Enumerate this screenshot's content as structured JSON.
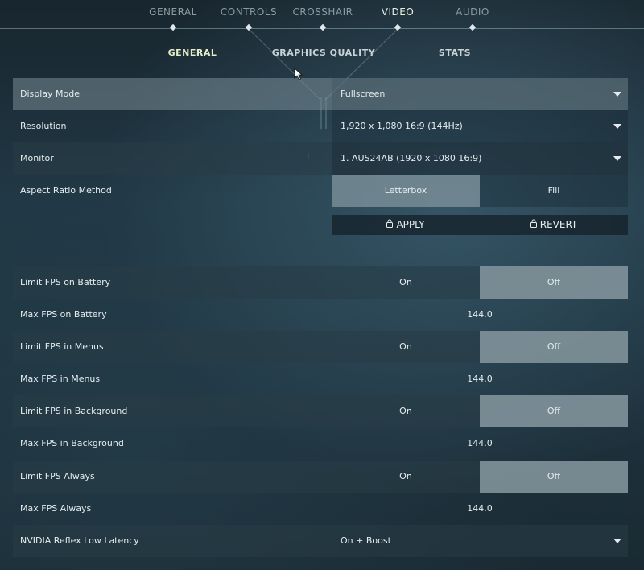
{
  "top_tabs": [
    {
      "label": "GENERAL",
      "active": false
    },
    {
      "label": "CONTROLS",
      "active": false
    },
    {
      "label": "CROSSHAIR",
      "active": false
    },
    {
      "label": "VIDEO",
      "active": true
    },
    {
      "label": "AUDIO",
      "active": false
    }
  ],
  "sub_tabs": [
    {
      "label": "GENERAL",
      "active": true
    },
    {
      "label": "GRAPHICS QUALITY",
      "active": false
    },
    {
      "label": "STATS",
      "active": false
    }
  ],
  "settings": {
    "display_mode": {
      "label": "Display Mode",
      "value": "Fullscreen"
    },
    "resolution": {
      "label": "Resolution",
      "value": "1,920 x 1,080 16:9 (144Hz)"
    },
    "monitor": {
      "label": "Monitor",
      "value": "1. AUS24AB (1920 x  1080 16:9)"
    },
    "aspect_ratio": {
      "label": "Aspect Ratio Method",
      "option_a": "Letterbox",
      "option_b": "Fill",
      "selected": "Letterbox"
    },
    "apply_label": "APPLY",
    "revert_label": "REVERT",
    "limit_fps_battery": {
      "label": "Limit FPS on Battery",
      "option_a": "On",
      "option_b": "Off",
      "selected": "Off"
    },
    "max_fps_battery": {
      "label": "Max FPS on Battery",
      "value": "144.0"
    },
    "limit_fps_menus": {
      "label": "Limit FPS in Menus",
      "option_a": "On",
      "option_b": "Off",
      "selected": "Off"
    },
    "max_fps_menus": {
      "label": "Max FPS in Menus",
      "value": "144.0"
    },
    "limit_fps_background": {
      "label": "Limit FPS in Background",
      "option_a": "On",
      "option_b": "Off",
      "selected": "Off"
    },
    "max_fps_background": {
      "label": "Max FPS in Background",
      "value": "144.0"
    },
    "limit_fps_always": {
      "label": "Limit FPS Always",
      "option_a": "On",
      "option_b": "Off",
      "selected": "Off"
    },
    "max_fps_always": {
      "label": "Max FPS Always",
      "value": "144.0"
    },
    "nvidia_reflex": {
      "label": "NVIDIA Reflex Low Latency",
      "value": "On + Boost"
    }
  },
  "icons": {
    "dropdown": "chevron-down-icon",
    "lock": "lock-icon",
    "cursor": "mouse-cursor-icon"
  }
}
